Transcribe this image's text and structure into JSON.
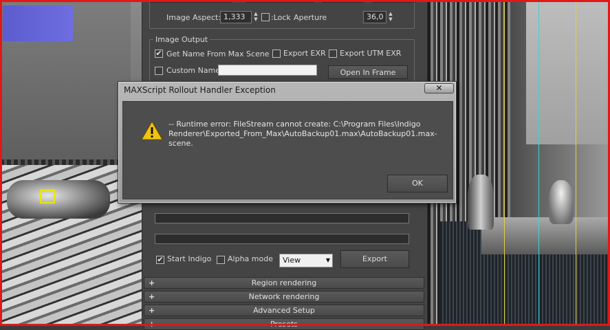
{
  "panel": {
    "image_aspect_label": "Image Aspect:",
    "image_aspect_value": "1,333",
    "lock_label": ":Lock",
    "aperture_label": "Aperture",
    "aperture_value": "36,0",
    "image_output_title": "Image Output",
    "get_name_label": "Get Name From Max Scene",
    "get_name_checked": "✔",
    "export_exr_label": "Export EXR",
    "export_utm_exr_label": "Export UTM EXR",
    "custom_name_label": "Custom Name:",
    "custom_name_value": "",
    "open_frame_buffer_label": "Open In Frame Buffer",
    "start_indigo_label": "Start Indigo",
    "start_indigo_checked": "✔",
    "alpha_mode_label": "Alpha mode",
    "view_select_value": "View",
    "export_button_label": "Export"
  },
  "rollouts": [
    {
      "label": "Region rendering"
    },
    {
      "label": "Network rendering"
    },
    {
      "label": "Advanced Setup"
    },
    {
      "label": "Presets"
    }
  ],
  "dialog": {
    "title": "MAXScript Rollout Handler Exception",
    "close_label": "✕",
    "message": "-- Runtime error: FileStream cannot create: C:\\Program Files\\Indigo Renderer\\Exported_From_Max\\AutoBackup01.max\\AutoBackup01.max-scene.",
    "ok_label": "OK"
  },
  "colors": {
    "frame_border": "#e01818",
    "warning_yellow": "#f2c40f",
    "guide_yellow": "#e0d040",
    "guide_cyan": "#40d0d8"
  }
}
